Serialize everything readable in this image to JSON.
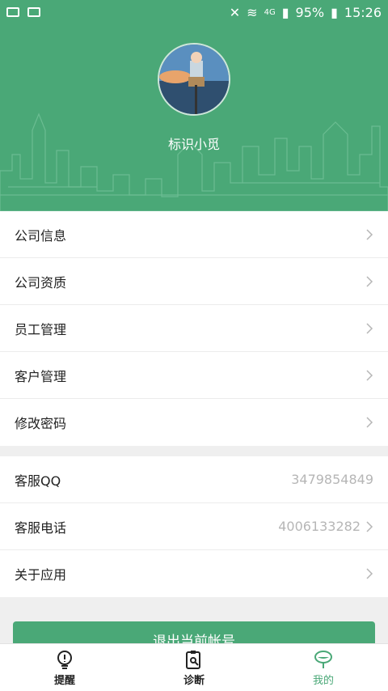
{
  "status_bar": {
    "battery": "95%",
    "time": "15:26",
    "network": "4G"
  },
  "profile": {
    "username": "标识小觅"
  },
  "menu_group1": [
    {
      "label": "公司信息"
    },
    {
      "label": "公司资质"
    },
    {
      "label": "员工管理"
    },
    {
      "label": "客户管理"
    },
    {
      "label": "修改密码"
    }
  ],
  "menu_group2": [
    {
      "label": "客服QQ",
      "value": "3479854849"
    },
    {
      "label": "客服电话",
      "value": "4006133282"
    },
    {
      "label": "关于应用",
      "value": ""
    }
  ],
  "logout_label": "退出当前帐号",
  "tabs": [
    {
      "label": "提醒",
      "icon": "bulb-icon"
    },
    {
      "label": "诊断",
      "icon": "clipboard-search-icon"
    },
    {
      "label": "我的",
      "icon": "user-icon"
    }
  ],
  "colors": {
    "accent": "#4aa877"
  }
}
